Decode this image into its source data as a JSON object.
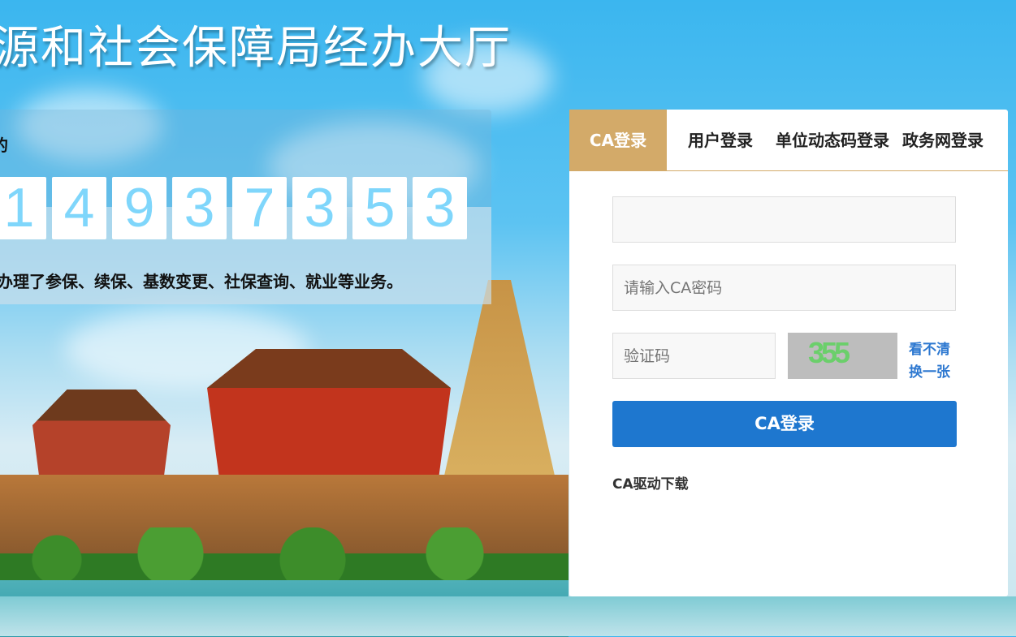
{
  "header": {
    "title": "源和社会保障局经办大厅"
  },
  "stats": {
    "label": "的",
    "digits": [
      "1",
      "4",
      "9",
      "3",
      "7",
      "3",
      "5",
      "3"
    ],
    "description": "办理了参保、续保、基数变更、社保查询、就业等业务。"
  },
  "login": {
    "tabs": [
      {
        "label": "CA登录",
        "active": true
      },
      {
        "label": "用户登录"
      },
      {
        "label": "单位动态码登录"
      },
      {
        "label": "政务网登录"
      }
    ],
    "ca_input": {
      "value": "",
      "placeholder": ""
    },
    "password": {
      "placeholder": "请输入CA密码"
    },
    "captcha": {
      "placeholder": "验证码",
      "image_text": "355"
    },
    "captcha_links": {
      "unclear": "看不清",
      "refresh": "换一张"
    },
    "submit_label": "CA登录",
    "driver_download": "CA驱动下载"
  },
  "colors": {
    "tab_active": "#d3aa69",
    "primary": "#1e77cf",
    "digit": "#7fd6fb",
    "link": "#2d78d0"
  }
}
